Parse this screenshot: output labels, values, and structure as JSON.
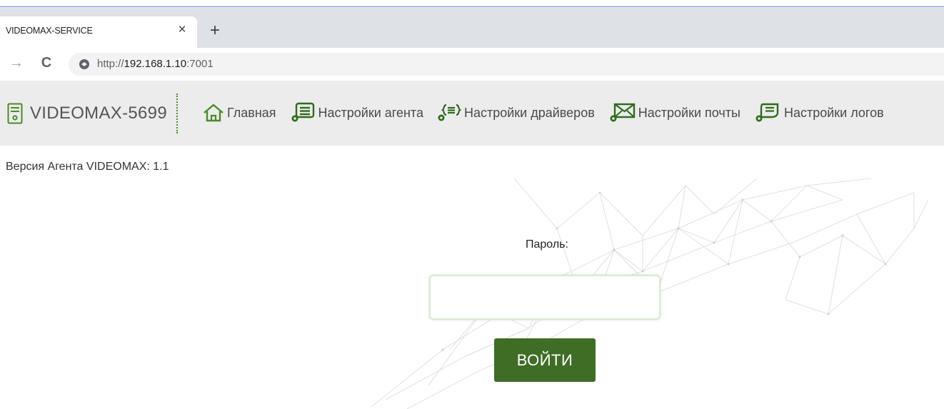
{
  "browser": {
    "tab_title": "VIDEOMAX-SERVICE",
    "tab_close_glyph": "×",
    "new_tab_glyph": "+",
    "url_scheme": "http://",
    "url_host": "192.168.1.10",
    "url_port": ":7001",
    "forward_icon": "→",
    "reload_icon": "C"
  },
  "app": {
    "brand": "VIDEOMAX-5699",
    "accent_color": "#4a8a2a",
    "menu": [
      {
        "label": "Главная",
        "icon": "home-icon"
      },
      {
        "label": "Настройки агента",
        "icon": "agent-settings-icon"
      },
      {
        "label": "Настройки драйверов",
        "icon": "driver-settings-icon"
      },
      {
        "label": "Настройки почты",
        "icon": "mail-settings-icon"
      },
      {
        "label": "Настройки логов",
        "icon": "log-settings-icon"
      }
    ]
  },
  "content": {
    "version_text": "Версия Агента VIDEOMAX: 1.1",
    "password_label": "Пароль:",
    "password_value": "",
    "login_button": "ВОЙТИ",
    "button_color": "#3f6d26"
  }
}
